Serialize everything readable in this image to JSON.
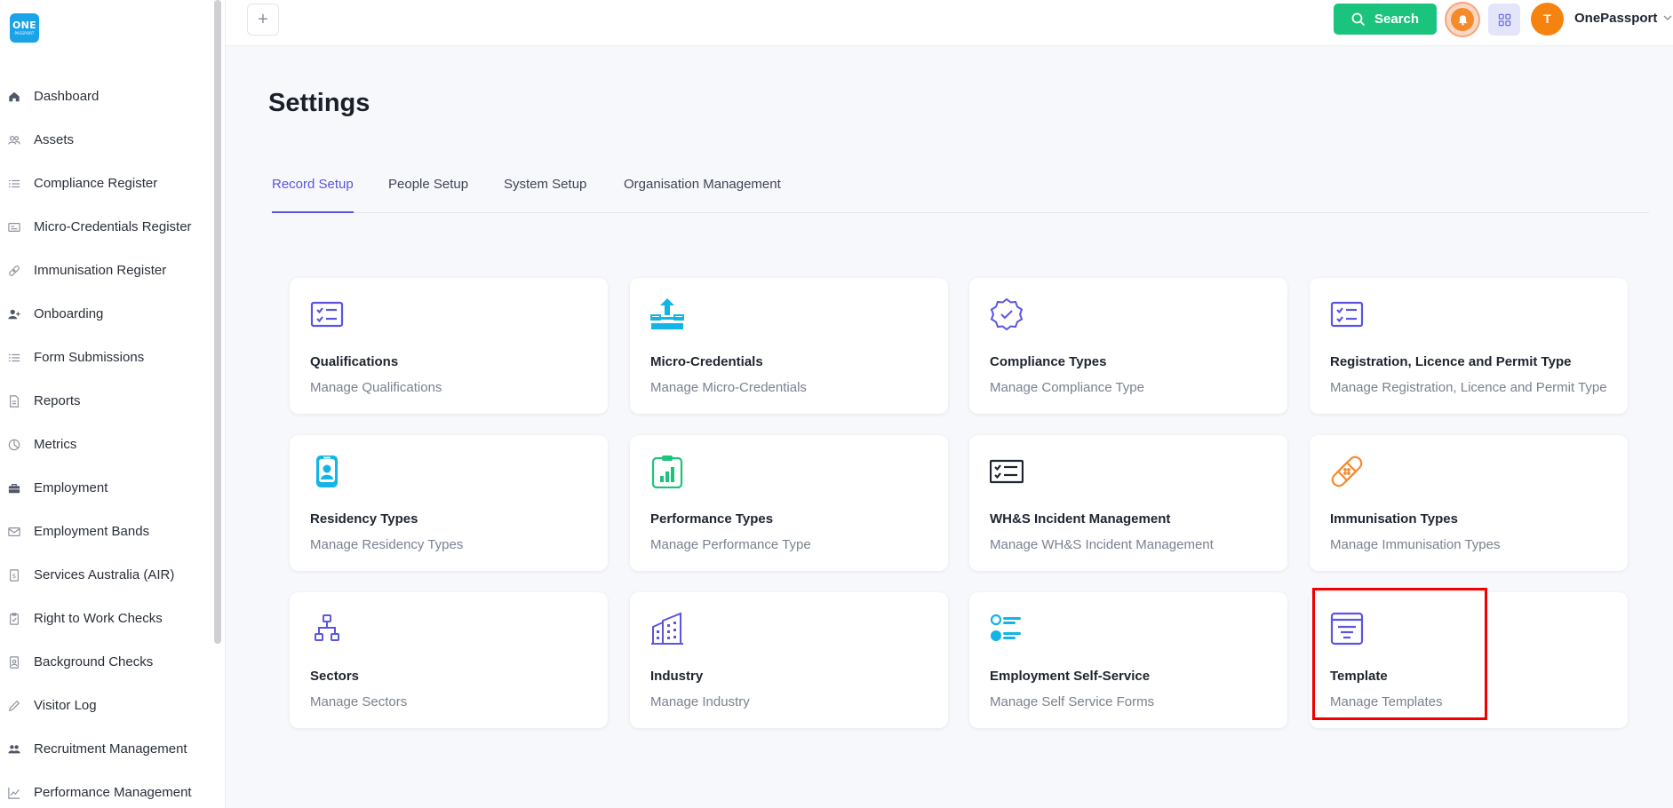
{
  "logo": {
    "line1": "ONE",
    "line2": "PASSPORT"
  },
  "sidebar": {
    "items": [
      {
        "label": "Dashboard",
        "icon": "home-icon"
      },
      {
        "label": "Assets",
        "icon": "users-icon"
      },
      {
        "label": "Compliance Register",
        "icon": "list-icon"
      },
      {
        "label": "Micro-Credentials Register",
        "icon": "id-card-icon"
      },
      {
        "label": "Immunisation Register",
        "icon": "bandage-icon"
      },
      {
        "label": "Onboarding",
        "icon": "user-plus-icon"
      },
      {
        "label": "Form Submissions",
        "icon": "list-icon"
      },
      {
        "label": "Reports",
        "icon": "document-icon"
      },
      {
        "label": "Metrics",
        "icon": "pie-chart-icon"
      },
      {
        "label": "Employment",
        "icon": "briefcase-icon"
      },
      {
        "label": "Employment Bands",
        "icon": "mail-icon"
      },
      {
        "label": "Services Australia (AIR)",
        "icon": "document-dollar-icon"
      },
      {
        "label": "Right to Work Checks",
        "icon": "clipboard-check-icon"
      },
      {
        "label": "Background Checks",
        "icon": "id-badge-icon"
      },
      {
        "label": "Visitor Log",
        "icon": "pen-icon"
      },
      {
        "label": "Recruitment Management",
        "icon": "group-icon"
      },
      {
        "label": "Performance Management",
        "icon": "trend-icon"
      }
    ]
  },
  "topbar": {
    "add_label": "+",
    "search_label": "Search",
    "avatar_initial": "T",
    "user_name": "OnePassport"
  },
  "page": {
    "title": "Settings",
    "tabs": [
      {
        "label": "Record Setup",
        "active": true
      },
      {
        "label": "People Setup",
        "active": false
      },
      {
        "label": "System Setup",
        "active": false
      },
      {
        "label": "Organisation Management",
        "active": false
      }
    ]
  },
  "cards": [
    {
      "title": "Qualifications",
      "subtitle": "Manage Qualifications",
      "icon": "checklist-icon",
      "color": "#5b55e0"
    },
    {
      "title": "Micro-Credentials",
      "subtitle": "Manage Micro-Credentials",
      "icon": "upload-stack-icon",
      "color": "#12b5e6"
    },
    {
      "title": "Compliance Types",
      "subtitle": "Manage Compliance Type",
      "icon": "verified-badge-icon",
      "color": "#5b55e0"
    },
    {
      "title": "Registration, Licence and Permit Type",
      "subtitle": "Manage Registration, Licence and Permit Type",
      "icon": "checklist-icon",
      "color": "#5b55e0"
    },
    {
      "title": "Residency Types",
      "subtitle": "Manage Residency Types",
      "icon": "id-badge-icon",
      "color": "#12b5e6"
    },
    {
      "title": "Performance Types",
      "subtitle": "Manage Performance Type",
      "icon": "clipboard-chart-icon",
      "color": "#1bc47d"
    },
    {
      "title": "WH&S Incident Management",
      "subtitle": "Manage WH&S Incident Management",
      "icon": "checklist-box-icon",
      "color": "#1f2430"
    },
    {
      "title": "Immunisation Types",
      "subtitle": "Manage Immunisation Types",
      "icon": "bandage-icon",
      "color": "#f58a2a"
    },
    {
      "title": "Sectors",
      "subtitle": "Manage Sectors",
      "icon": "hierarchy-icon",
      "color": "#5b55e0"
    },
    {
      "title": "Industry",
      "subtitle": "Manage Industry",
      "icon": "buildings-icon",
      "color": "#5b55e0"
    },
    {
      "title": "Employment Self-Service",
      "subtitle": "Manage Self Service Forms",
      "icon": "toggle-list-icon",
      "color": "#12b5e6"
    },
    {
      "title": "Template",
      "subtitle": "Manage Templates",
      "icon": "template-icon",
      "color": "#5b55e0"
    }
  ]
}
